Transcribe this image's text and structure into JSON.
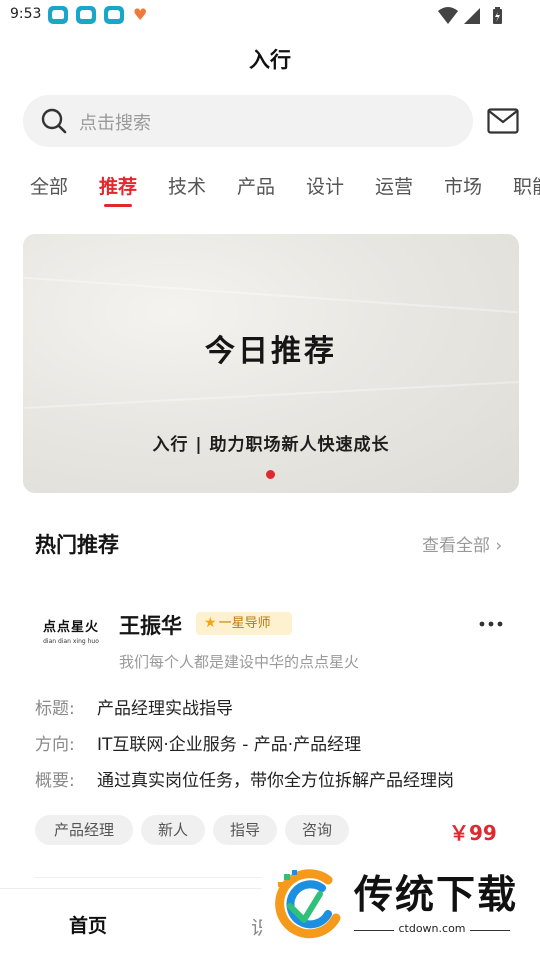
{
  "status_bar": {
    "time": "9:53",
    "notification_icons": [
      "app-notification-icon",
      "app-notification-icon",
      "app-notification-icon",
      "heart-notification-icon"
    ],
    "system_icons": [
      "wifi-icon",
      "signal-icon",
      "battery-icon"
    ]
  },
  "header": {
    "title": "入行"
  },
  "search": {
    "placeholder": "点击搜索"
  },
  "tabs": [
    {
      "label": "全部"
    },
    {
      "label": "推荐",
      "active": true
    },
    {
      "label": "技术"
    },
    {
      "label": "产品"
    },
    {
      "label": "设计"
    },
    {
      "label": "运营"
    },
    {
      "label": "市场"
    },
    {
      "label": "职能"
    }
  ],
  "banner": {
    "title": "今日推荐",
    "subtitle": "入行 | 助力职场新人快速成长",
    "slide_count": 1,
    "active_slide": 1
  },
  "section": {
    "title": "热门推荐",
    "view_all": "查看全部 ›"
  },
  "mentor": {
    "logo_text": "点点星火",
    "logo_subtext": "dian dian xing huo",
    "name": "王振华",
    "badge": "一星导师",
    "bio": "我们每个人都是建设中华的点点星火",
    "rows": [
      {
        "label": "标题:",
        "value": "产品经理实战指导"
      },
      {
        "label": "方向:",
        "value": "IT互联网·企业服务 - 产品·产品经理"
      },
      {
        "label": "概要:",
        "value": "通过真实岗位任务，带你全方位拆解产品经理岗"
      }
    ],
    "tags": [
      "产品经理",
      "新人",
      "指导",
      "咨询"
    ],
    "price": "￥99"
  },
  "bottom_nav": {
    "home": "首页",
    "second_partial": "识"
  },
  "watermark": {
    "text": "传统下载",
    "url": "ctdown.com"
  },
  "colors": {
    "accent": "#e0282e",
    "badge_bg": "#fdf1cf",
    "badge_text": "#b97b07"
  }
}
